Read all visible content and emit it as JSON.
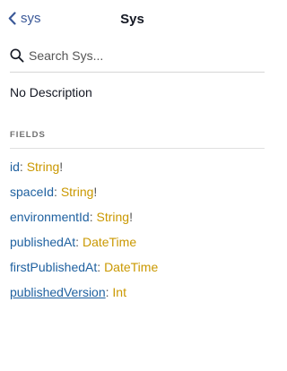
{
  "header": {
    "back_label": "sys",
    "title": "Sys"
  },
  "search": {
    "placeholder": "Search Sys...",
    "value": ""
  },
  "description": "No Description",
  "fields_section": {
    "heading": "FIELDS",
    "separator": ":",
    "items": [
      {
        "name": "id",
        "type": "String",
        "suffix": "!"
      },
      {
        "name": "spaceId",
        "type": "String",
        "suffix": "!"
      },
      {
        "name": "environmentId",
        "type": "String",
        "suffix": "!"
      },
      {
        "name": "publishedAt",
        "type": "DateTime",
        "suffix": ""
      },
      {
        "name": "firstPublishedAt",
        "type": "DateTime",
        "suffix": ""
      },
      {
        "name": "publishedVersion",
        "type": "Int",
        "suffix": ""
      }
    ]
  },
  "colors": {
    "back_link": "#3B5998",
    "field_name": "#1f61a0",
    "field_type": "#CA9800",
    "section_heading": "#707070"
  },
  "icons": {
    "back": "chevron-left-icon",
    "search": "search-icon"
  }
}
